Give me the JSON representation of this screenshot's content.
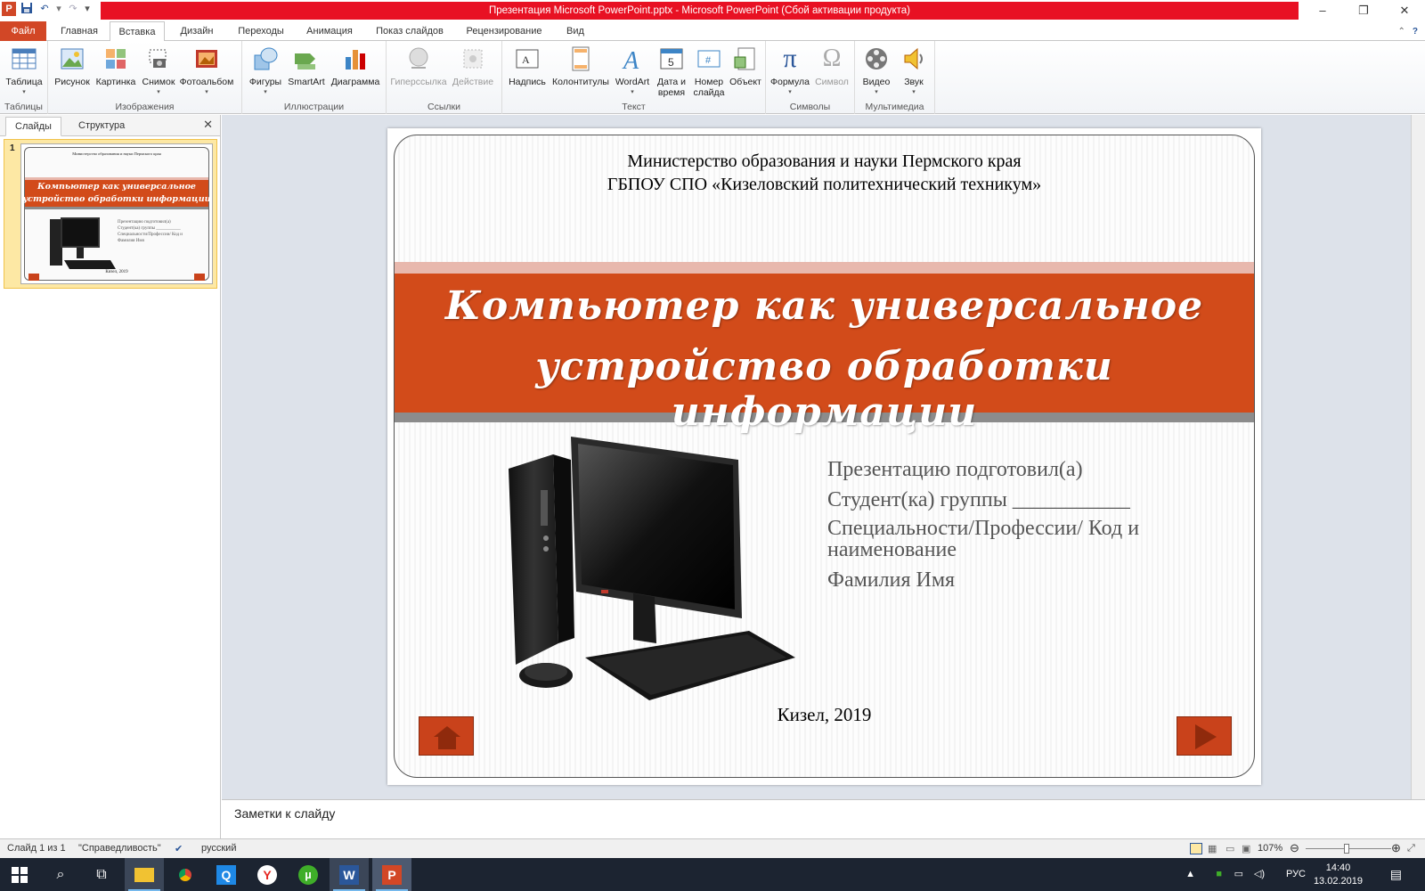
{
  "window": {
    "title": "Презентация Microsoft PowerPoint.pptx  -  Microsoft PowerPoint (Сбой активации продукта)",
    "controls": {
      "minimize": "–",
      "restore": "❐",
      "close": "✕"
    }
  },
  "tabs": [
    "Файл",
    "Главная",
    "Вставка",
    "Дизайн",
    "Переходы",
    "Анимация",
    "Показ слайдов",
    "Рецензирование",
    "Вид"
  ],
  "ribbon": {
    "groups": [
      {
        "label": "Таблицы",
        "buttons": [
          "Таблица"
        ]
      },
      {
        "label": "Изображения",
        "buttons": [
          "Рисунок",
          "Картинка",
          "Снимок",
          "Фотоальбом"
        ]
      },
      {
        "label": "Иллюстрации",
        "buttons": [
          "Фигуры",
          "SmartArt",
          "Диаграмма"
        ]
      },
      {
        "label": "Ссылки",
        "buttons": [
          "Гиперссылка",
          "Действие"
        ]
      },
      {
        "label": "Текст",
        "buttons": [
          "Надпись",
          "Колонтитулы",
          "WordArt",
          "Дата и время",
          "Номер слайда",
          "Объект"
        ]
      },
      {
        "label": "Символы",
        "buttons": [
          "Формула",
          "Символ"
        ]
      },
      {
        "label": "Мультимедиа",
        "buttons": [
          "Видео",
          "Звук"
        ]
      }
    ]
  },
  "left_pane": {
    "tabs": [
      "Слайды",
      "Структура"
    ],
    "close": "✕",
    "slide_number": "1"
  },
  "slide": {
    "org_line1": "Министерство образования и науки Пермского края",
    "org_line2": "ГБПОУ СПО «Кизеловский политехнический техникум»",
    "title_line1": "Компьютер как универсальное",
    "title_line2": "устройство обработки информации",
    "info_line1": "Презентацию подготовил(а)",
    "info_line2": "Студент(ка) группы ___________",
    "info_line3": "Специальности/Профессии/ Код и",
    "info_line4": "наименование",
    "info_line5": "Фамилия Имя",
    "city": "Кизел, 2019"
  },
  "notes": {
    "placeholder": "Заметки к слайду"
  },
  "status": {
    "slide_info": "Слайд 1 из 1",
    "theme": "\"Справедливость\"",
    "language": "русский",
    "zoom": "107%"
  },
  "taskbar": {
    "time": "14:40",
    "date": "13.02.2019",
    "lang": "РУС"
  },
  "colors": {
    "accent": "#d24726",
    "title_band": "#d24b1a",
    "taskbar": "#1c2431",
    "title_bar": "#e81123"
  }
}
